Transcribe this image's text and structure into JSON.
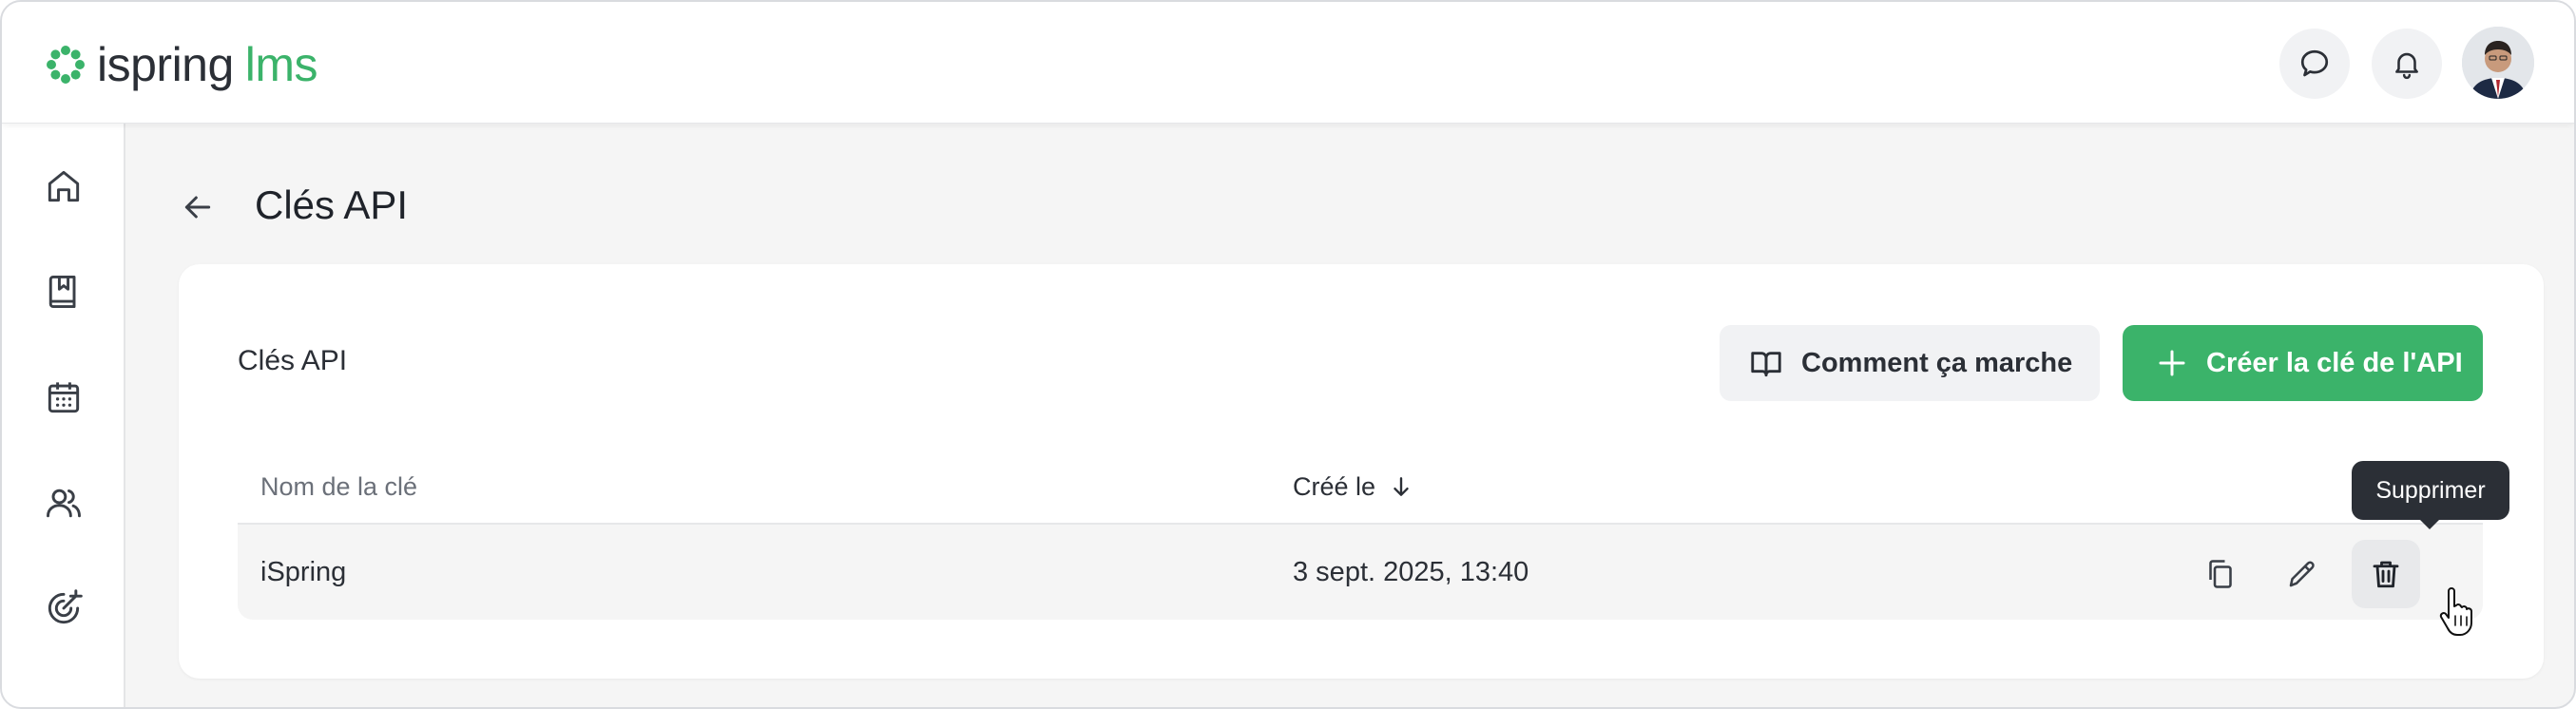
{
  "app": {
    "logo_text_1": "ispring",
    "logo_text_2": "lms",
    "brand_color": "#3bb36a"
  },
  "header": {
    "chat_icon": "chat-bubble-icon",
    "notifications_icon": "bell-icon",
    "avatar": "user-avatar"
  },
  "sidebar": {
    "items": [
      {
        "name": "home",
        "icon": "home-icon"
      },
      {
        "name": "library",
        "icon": "book-icon"
      },
      {
        "name": "calendar",
        "icon": "calendar-icon"
      },
      {
        "name": "users",
        "icon": "users-icon"
      },
      {
        "name": "goals",
        "icon": "target-icon"
      }
    ]
  },
  "page": {
    "title": "Clés API",
    "back_icon": "arrow-left-icon"
  },
  "card": {
    "title": "Clés API",
    "help_button": "Comment ça marche",
    "create_button": "Créer la clé de l'API"
  },
  "table": {
    "columns": [
      "Nom de la clé",
      "Créé le"
    ],
    "sort_icon": "arrow-down-icon",
    "rows": [
      {
        "name": "iSpring",
        "created": "3 sept. 2025, 13:40"
      }
    ]
  },
  "tooltip": {
    "text": "Supprimer"
  }
}
